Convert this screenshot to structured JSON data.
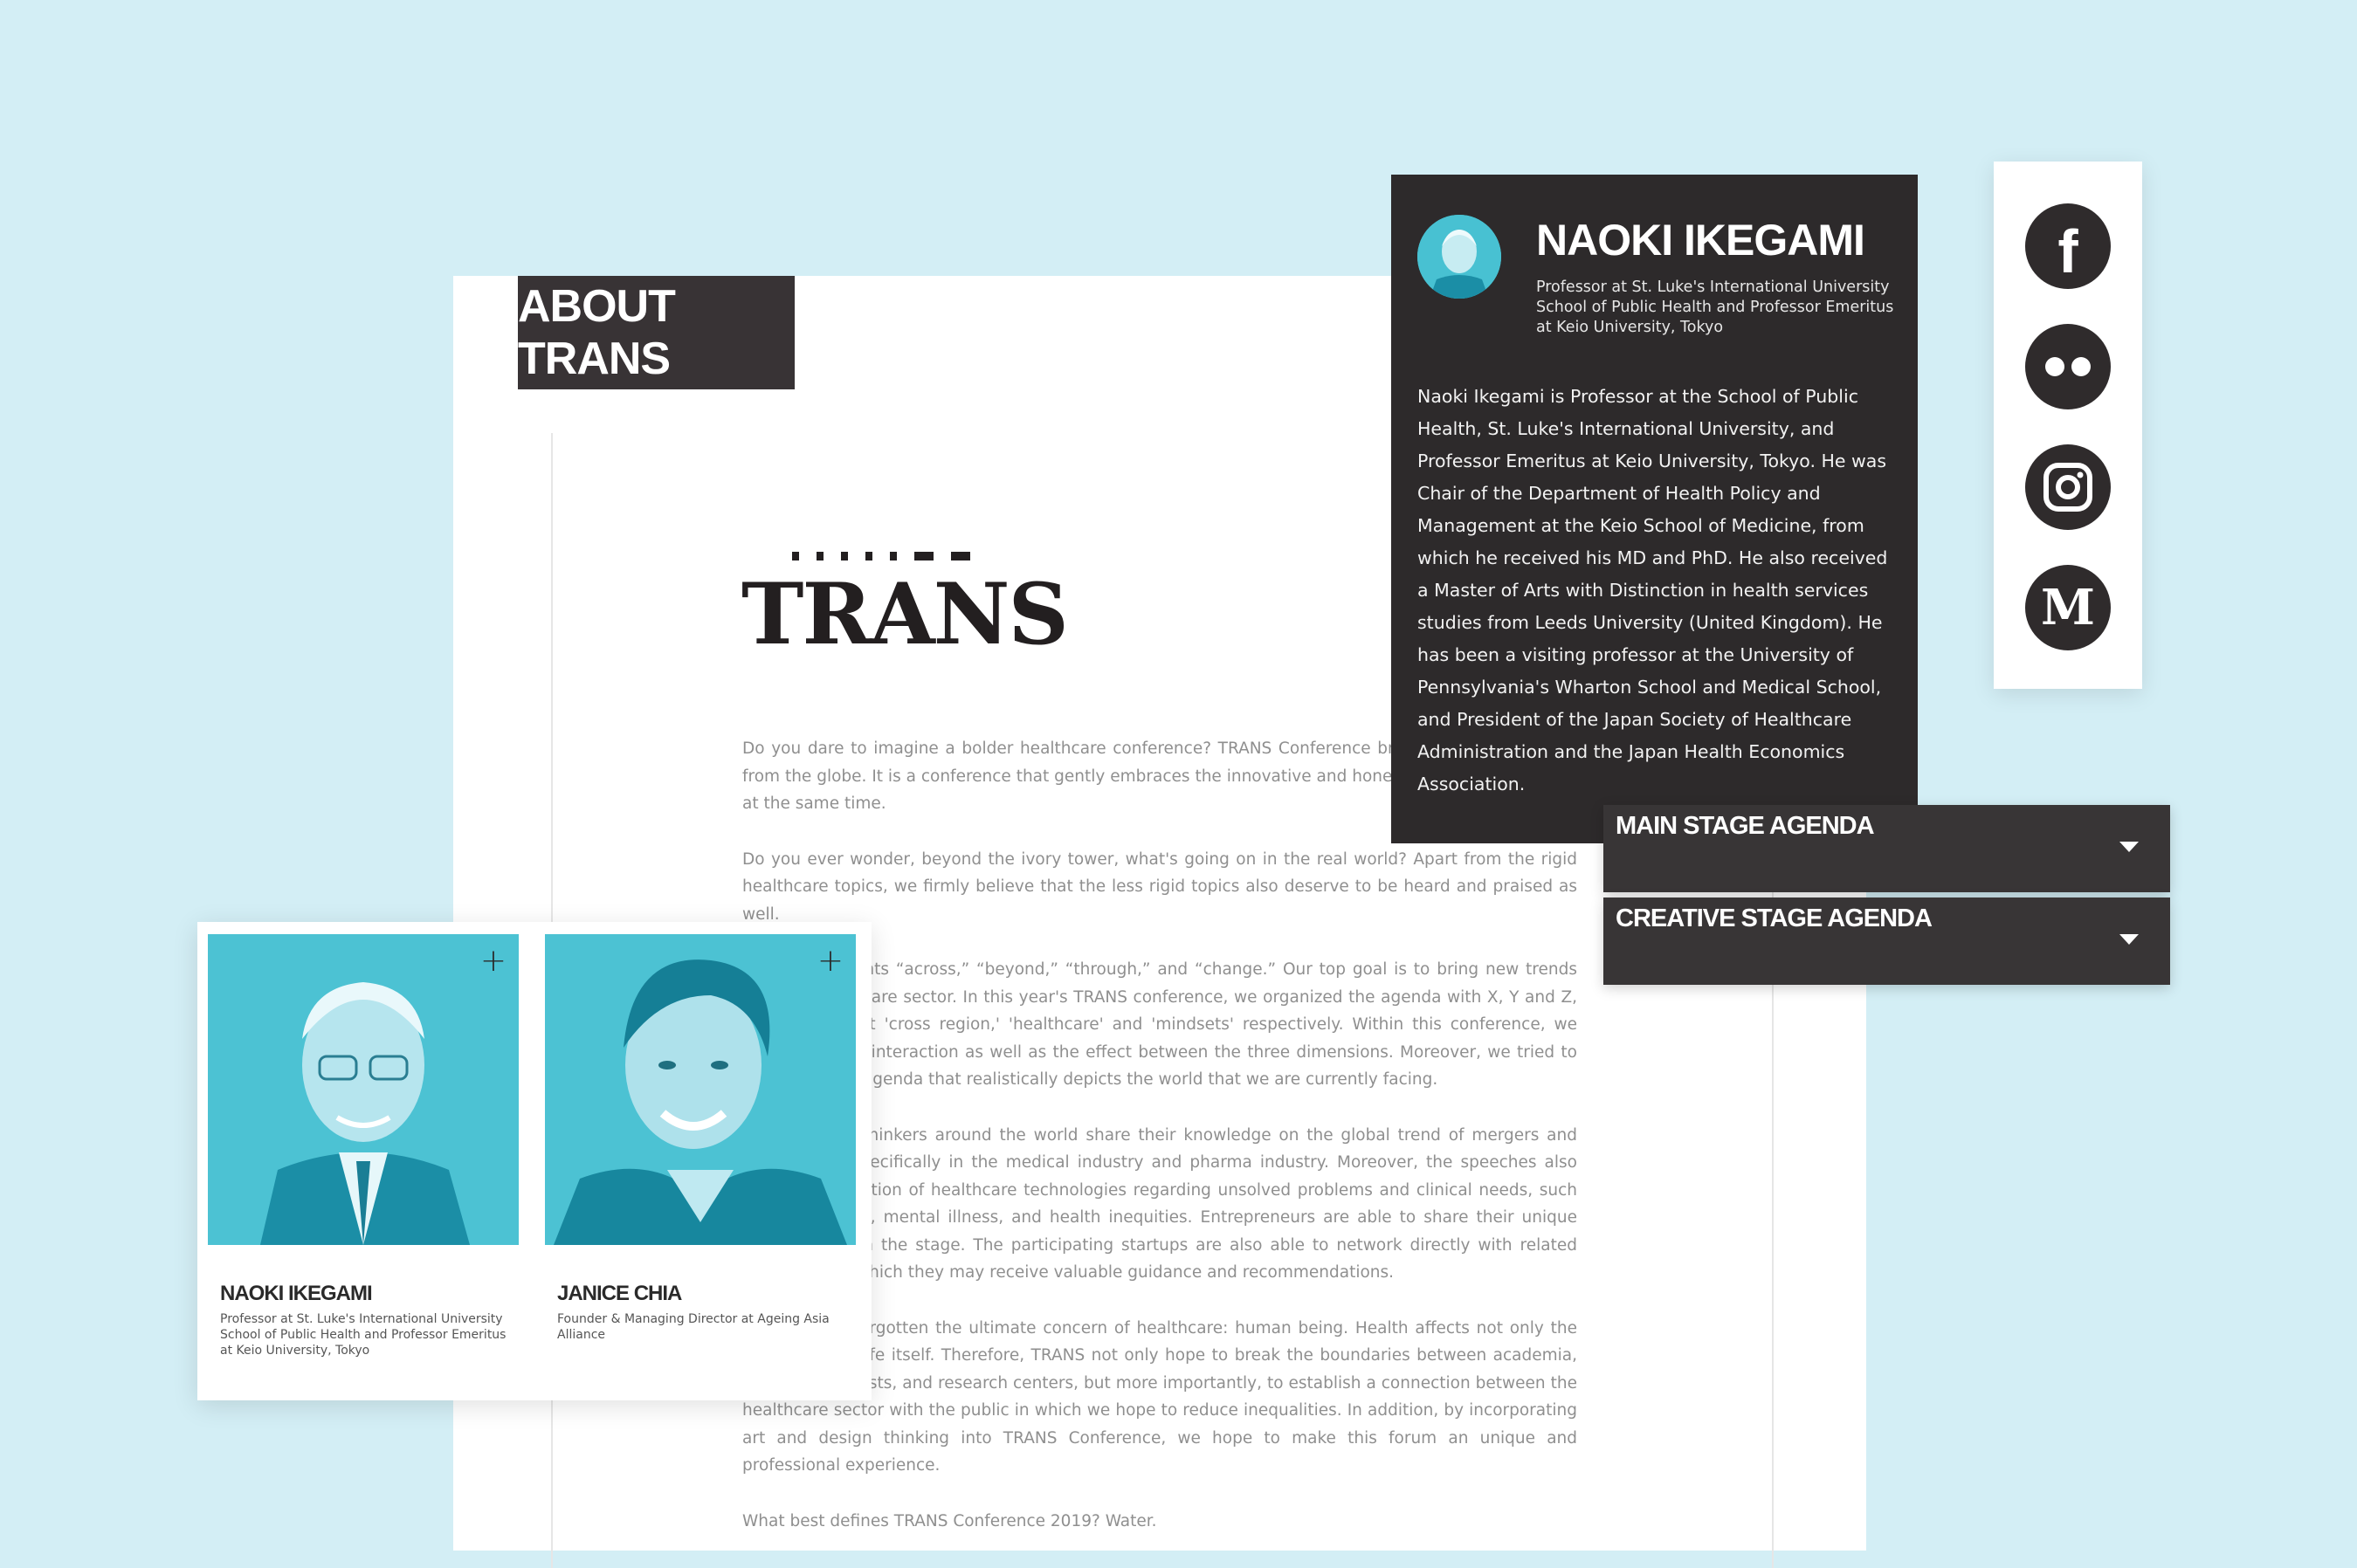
{
  "about": {
    "tab_label": "ABOUT TRANS"
  },
  "logo": {
    "word": "TRANS"
  },
  "article": {
    "paragraphs": [
      "Do you dare to imagine a bolder healthcare conference? TRANS Conference brings together startups from the globe. It is a conference that gently embraces the innovative and honest insights of the world at the same time.",
      "Do you ever wonder, beyond the ivory tower, what's going on in the real world? Apart from the rigid healthcare topics, we firmly believe that the less rigid topics also deserve to be heard and praised as well.",
      "TRANS represents “across,” “beyond,” “through,” and “change.” Our top goal is to bring new trends into the healthcare sector. In this year's TRANS conference, we organized the agenda with X, Y and Z, which represent 'cross region,' 'healthcare' and 'mindsets' respectively. Within this conference, we focused on the interaction as well as the effect between the three dimensions. Moreover, we tried to build a unique agenda that realistically depicts the world that we are currently facing.",
      "Speakers and thinkers around the world share their knowledge on the global trend of mergers and acquisitions, specifically in the medical industry and pharma industry. Moreover, the speeches also cover the evolution of healthcare technologies regarding unsolved problems and clinical needs, such as rare disease, mental illness, and health inequities. Entrepreneurs are able to share their unique perspectives on the stage. The participating startups are also able to network directly with related stakeholders, which they may receive valuable guidance and recommendations.",
      "We have not forgotten the ultimate concern of healthcare: human being. Health affects not only the body, but the life itself. Therefore, TRANS not only hope to break the boundaries between academia, venture capitalists, and research centers, but more importantly, to establish a connection between the healthcare sector with the public in which we hope to reduce inequalities. In addition, by incorporating art and design thinking into TRANS Conference, we hope to make this forum an unique and professional experience.",
      "What best defines TRANS Conference 2019? Water."
    ]
  },
  "speakers": [
    {
      "name": "NAOKI IKEGAMI",
      "role": "Professor at St. Luke's International University School of Public Health and Professor Emeritus at Keio University, Tokyo",
      "plus": "+"
    },
    {
      "name": "JANICE CHIA",
      "role": "Founder & Managing Director at Ageing Asia Alliance",
      "plus": "+"
    }
  ],
  "popup": {
    "name": "NAOKI IKEGAMI",
    "title": "Professor at St. Luke's International University School of Public Health and Professor Emeritus at Keio University, Tokyo",
    "bio": "Naoki Ikegami is Professor at the School of Public Health, St. Luke's International University, and Professor Emeritus at Keio University, Tokyo. He was Chair of the Department of Health Policy and Management at the Keio School of Medicine, from which he received his MD and PhD. He also received a Master of Arts with Distinction in health services studies from Leeds University (United Kingdom). He has been a visiting professor at the University of Pennsylvania's Wharton School and Medical School, and President of the Japan Society of Healthcare Administration and the Japan Health Economics Association."
  },
  "agenda": [
    {
      "label": "MAIN STAGE AGENDA"
    },
    {
      "label": "CREATIVE STAGE AGENDA"
    }
  ],
  "social": [
    {
      "icon": "facebook-icon",
      "glyph": "f"
    },
    {
      "icon": "flickr-icon",
      "glyph": ""
    },
    {
      "icon": "instagram-icon",
      "glyph": ""
    },
    {
      "icon": "medium-icon",
      "glyph": "M"
    }
  ],
  "colors": {
    "background": "#d3eef5",
    "dark": "#2d2a2b",
    "accent": "#48c1d2"
  }
}
